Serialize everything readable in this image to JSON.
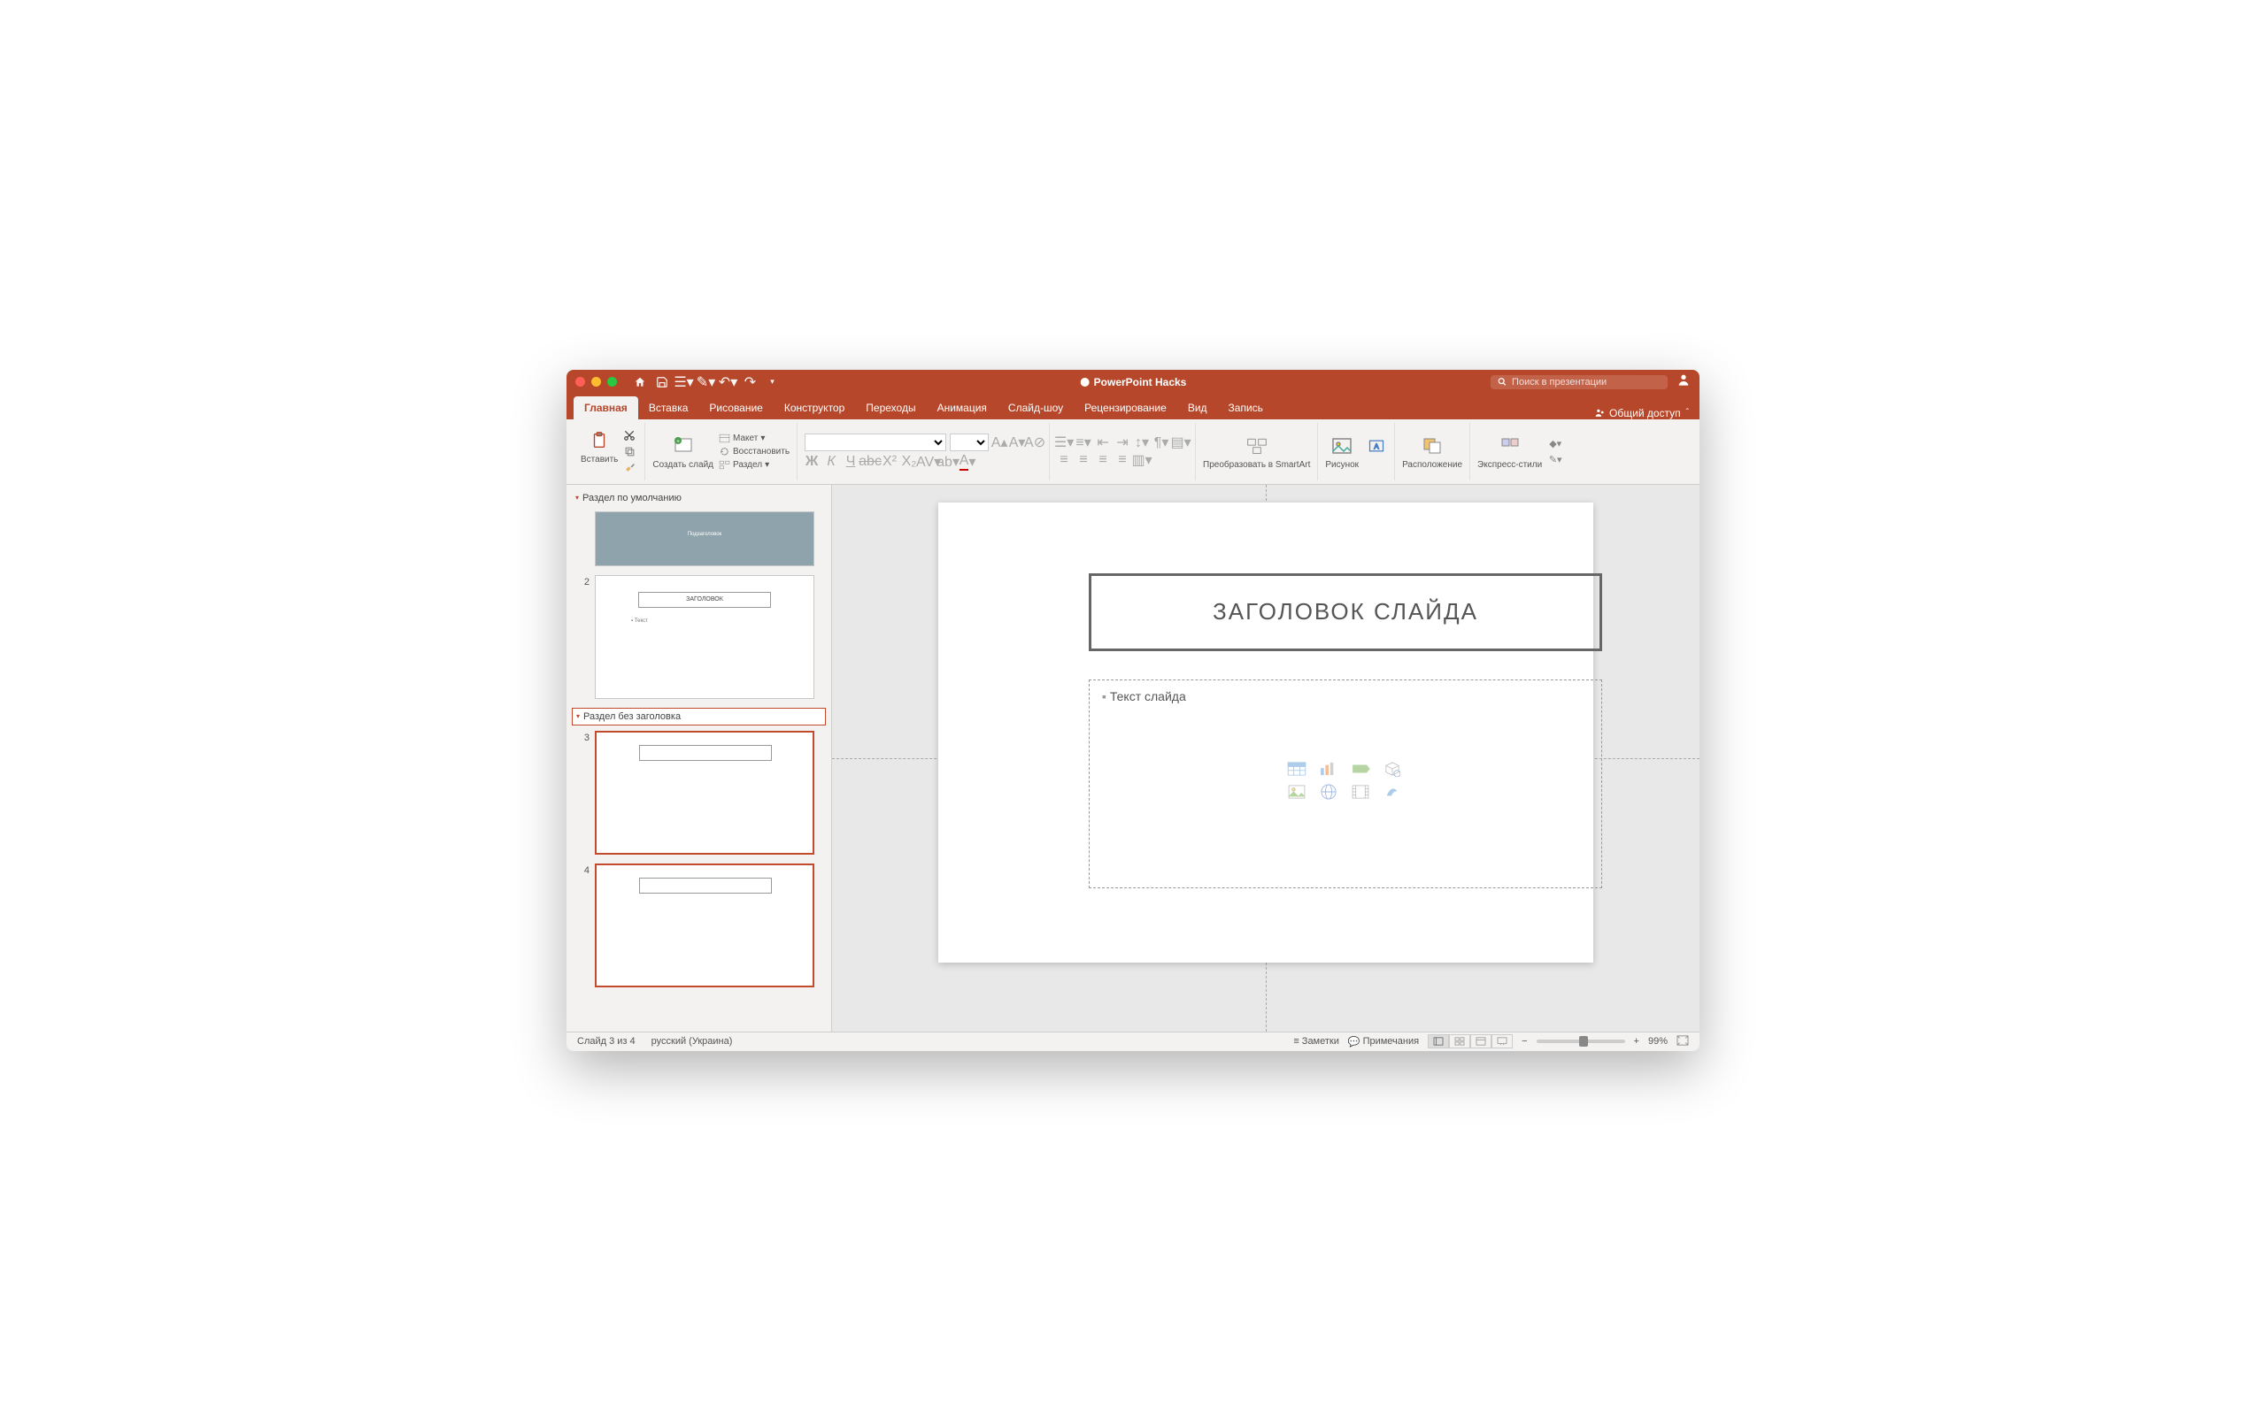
{
  "title": "PowerPoint Hacks",
  "search_placeholder": "Поиск в презентации",
  "tabs": {
    "home": "Главная",
    "insert": "Вставка",
    "draw": "Рисование",
    "design": "Конструктор",
    "transitions": "Переходы",
    "animation": "Анимация",
    "slideshow": "Слайд-шоу",
    "review": "Рецензирование",
    "view": "Вид",
    "record": "Запись"
  },
  "share": "Общий доступ",
  "ribbon": {
    "paste": "Вставить",
    "new_slide": "Создать слайд",
    "layout": "Макет",
    "reset": "Восстановить",
    "section": "Раздел",
    "convert_smartart": "Преобразовать в SmartArt",
    "picture": "Рисунок",
    "arrange": "Расположение",
    "quick_styles": "Экспресс-стили"
  },
  "thumbs": {
    "section_default": "Раздел по умолчанию",
    "section_untitled": "Раздел без заголовка",
    "slide_nums": {
      "s2": "2",
      "s3": "3",
      "s4": "4"
    },
    "thumb1_text": "Подзаголовок",
    "thumb2_header": "ЗАГОЛОВОК",
    "thumb2_text": "Текст"
  },
  "slide": {
    "title": "ЗАГОЛОВОК СЛАЙДА",
    "body": "Текст слайда"
  },
  "statusbar": {
    "slide_count": "Слайд 3 из 4",
    "language": "русский (Украина)",
    "notes": "Заметки",
    "comments": "Примечания",
    "zoom": "99%"
  }
}
